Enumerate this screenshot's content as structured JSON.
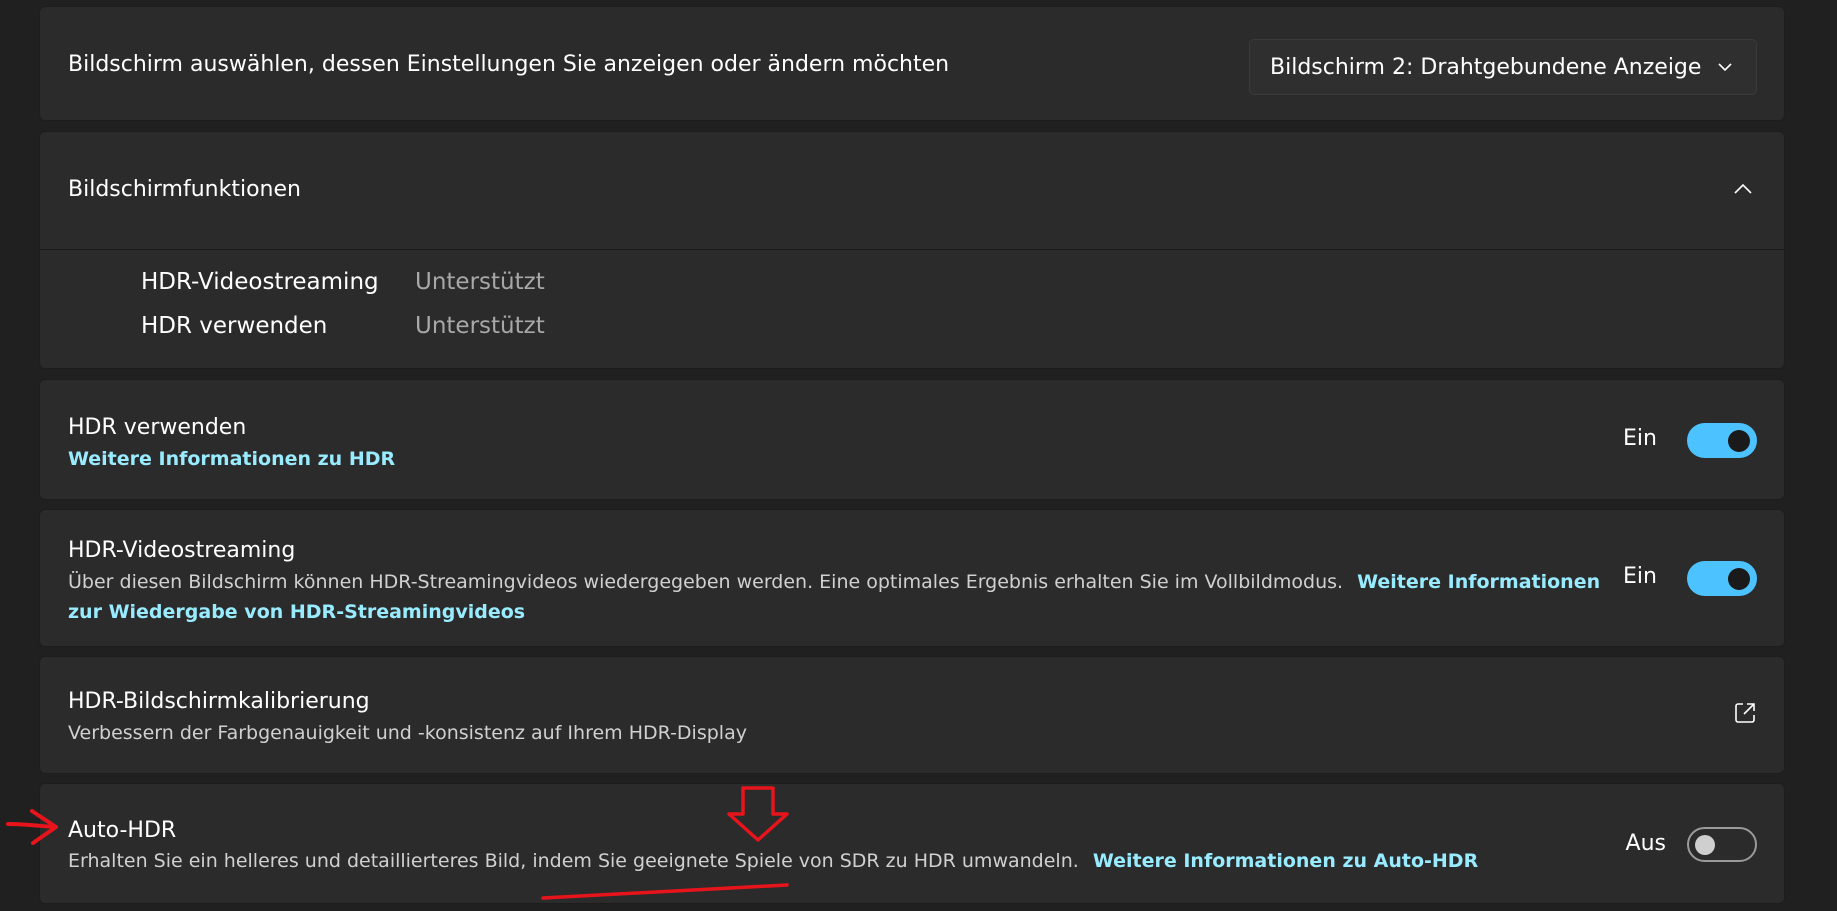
{
  "display_select": {
    "label": "Bildschirm auswählen, dessen Einstellungen Sie anzeigen oder ändern möchten",
    "selected_value": "Bildschirm 2: Drahtgebundene Anzeige"
  },
  "display_features": {
    "title": "Bildschirmfunktionen",
    "items": [
      {
        "name": "HDR-Videostreaming",
        "value": "Unterstützt"
      },
      {
        "name": "HDR verwenden",
        "value": "Unterstützt"
      }
    ]
  },
  "use_hdr": {
    "title": "HDR verwenden",
    "link": "Weitere Informationen zu HDR",
    "state": "Ein"
  },
  "hdr_streaming": {
    "title": "HDR-Videostreaming",
    "description": "Über diesen Bildschirm können HDR-Streamingvideos wiedergegeben werden. Eine optimales Ergebnis erhalten Sie im Vollbildmodus.",
    "link": "Weitere Informationen zur Wiedergabe von HDR-Streamingvideos",
    "state": "Ein"
  },
  "hdr_calibration": {
    "title": "HDR-Bildschirmkalibrierung",
    "description": "Verbessern der Farbgenauigkeit und -konsistenz auf Ihrem HDR-Display",
    "icon": "open-external-icon"
  },
  "auto_hdr": {
    "title": "Auto-HDR",
    "description": "Erhalten Sie ein helleres und detaillierteres Bild, indem Sie geeignete Spiele von SDR zu HDR umwandeln.",
    "link": "Weitere Informationen zu Auto-HDR",
    "state": "Aus"
  },
  "colors": {
    "background": "#202020",
    "card": "#2b2b2b",
    "accent": "#4cc2ff",
    "link": "#99ebff",
    "annotation": "#e8141c"
  }
}
